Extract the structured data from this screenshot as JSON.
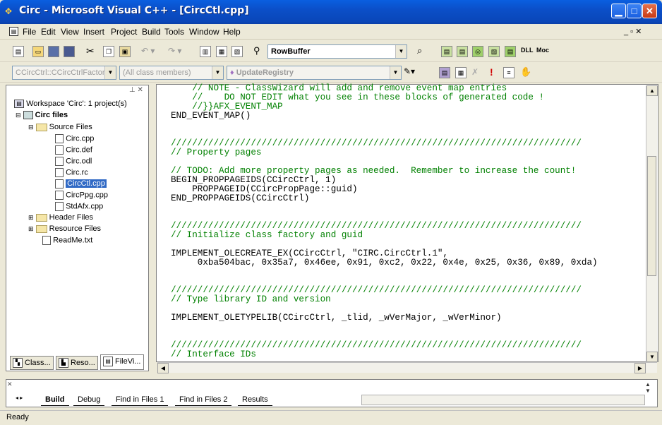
{
  "window": {
    "title": "Circ - Microsoft Visual C++ - [CircCtl.cpp]"
  },
  "menu": [
    "File",
    "Edit",
    "View",
    "Insert",
    "Project",
    "Build",
    "Tools",
    "Window",
    "Help"
  ],
  "toolbar": {
    "find_combo": "RowBuffer",
    "class_combo": "CCircCtrl::CCircCtrlFactory",
    "members_combo": "(All class members)",
    "function_combo": "UpdateRegistry"
  },
  "workspace": {
    "root": "Workspace 'Circ': 1 project(s)",
    "project": "Circ files",
    "source_folder": "Source Files",
    "source_files": [
      "Circ.cpp",
      "Circ.def",
      "Circ.odl",
      "Circ.rc",
      "CircCtl.cpp",
      "CircPpg.cpp",
      "StdAfx.cpp"
    ],
    "header_folder": "Header Files",
    "resource_folder": "Resource Files",
    "readme": "ReadMe.txt",
    "tabs": [
      "Class...",
      "Reso...",
      "FileVi..."
    ]
  },
  "code_lines": [
    {
      "t": "    // NOTE - ClassWizard will add and remove event map entries",
      "c": true
    },
    {
      "t": "    //    DO NOT EDIT what you see in these blocks of generated code !",
      "c": true
    },
    {
      "t": "    //}}AFX_EVENT_MAP",
      "c": true
    },
    {
      "t": "END_EVENT_MAP()",
      "c": false
    },
    {
      "t": "",
      "c": false
    },
    {
      "t": "",
      "c": false
    },
    {
      "t": "/////////////////////////////////////////////////////////////////////////////",
      "c": true
    },
    {
      "t": "// Property pages",
      "c": true
    },
    {
      "t": "",
      "c": false
    },
    {
      "t": "// TODO: Add more property pages as needed.  Remember to increase the count!",
      "c": true
    },
    {
      "t": "BEGIN_PROPPAGEIDS(CCircCtrl, 1)",
      "c": false
    },
    {
      "t": "    PROPPAGEID(CCircPropPage::guid)",
      "c": false
    },
    {
      "t": "END_PROPPAGEIDS(CCircCtrl)",
      "c": false
    },
    {
      "t": "",
      "c": false
    },
    {
      "t": "",
      "c": false
    },
    {
      "t": "/////////////////////////////////////////////////////////////////////////////",
      "c": true
    },
    {
      "t": "// Initialize class factory and guid",
      "c": true
    },
    {
      "t": "",
      "c": false
    },
    {
      "t": "IMPLEMENT_OLECREATE_EX(CCircCtrl, \"CIRC.CircCtrl.1\",",
      "c": false
    },
    {
      "t": "     0xba504bac, 0x35a7, 0x46ee, 0x91, 0xc2, 0x22, 0x4e, 0x25, 0x36, 0x89, 0xda)",
      "c": false
    },
    {
      "t": "",
      "c": false
    },
    {
      "t": "",
      "c": false
    },
    {
      "t": "/////////////////////////////////////////////////////////////////////////////",
      "c": true
    },
    {
      "t": "// Type library ID and version",
      "c": true
    },
    {
      "t": "",
      "c": false
    },
    {
      "t": "IMPLEMENT_OLETYPELIB(CCircCtrl, _tlid, _wVerMajor, _wVerMinor)",
      "c": false
    },
    {
      "t": "",
      "c": false
    },
    {
      "t": "",
      "c": false
    },
    {
      "t": "/////////////////////////////////////////////////////////////////////////////",
      "c": true
    },
    {
      "t": "// Interface IDs",
      "c": true
    }
  ],
  "output_tabs": [
    "Build",
    "Debug",
    "Find in Files 1",
    "Find in Files 2",
    "Results"
  ],
  "status": "Ready"
}
